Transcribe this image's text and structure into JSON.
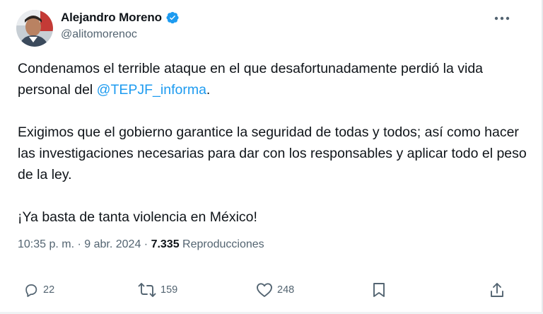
{
  "author": {
    "name": "Alejandro Moreno",
    "handle": "@alitomorenoc"
  },
  "tweet": {
    "line1_pre": "Condenamos el terrible ataque en el que desafortunadamente perdió la vida personal del ",
    "mention": "@TEPJF_informa",
    "line1_post": ".",
    "paragraph2": "Exigimos que el gobierno garantice la seguridad de todas y todos; así como hacer las investigaciones necesarias para dar con los responsables y aplicar todo el peso de la ley.",
    "paragraph3": "¡Ya basta de tanta violencia en México!"
  },
  "meta": {
    "time": "10:35 p. m.",
    "separator1": " · ",
    "date": "9 abr. 2024",
    "separator2": " · ",
    "views_count": "7.335",
    "views_label": " Reproducciones"
  },
  "actions": {
    "replies": "22",
    "reposts": "159",
    "likes": "248"
  },
  "colors": {
    "accent": "#1d9bf0",
    "text": "#0f1419",
    "secondary": "#536471"
  },
  "icons": {
    "verified": "verified-badge-icon",
    "more": "more-icon",
    "reply": "reply-icon",
    "repost": "repost-icon",
    "like": "like-icon",
    "bookmark": "bookmark-icon",
    "share": "share-icon"
  }
}
